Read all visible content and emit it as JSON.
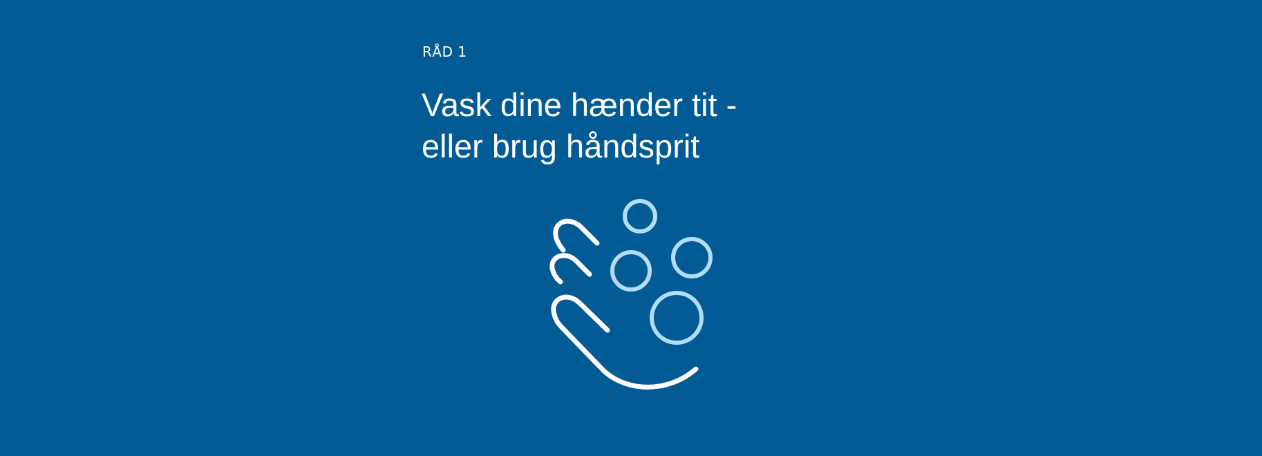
{
  "tip": {
    "eyebrow": "RÅD 1",
    "headline_line1": "Vask dine hænder tit -",
    "headline_line2": "eller brug håndsprit",
    "icon": "hand-washing-icon"
  },
  "colors": {
    "background": "#025b94",
    "text": "#ffffff",
    "hand_stroke": "#ffffff",
    "bubble_stroke": "#b4dcf8"
  }
}
